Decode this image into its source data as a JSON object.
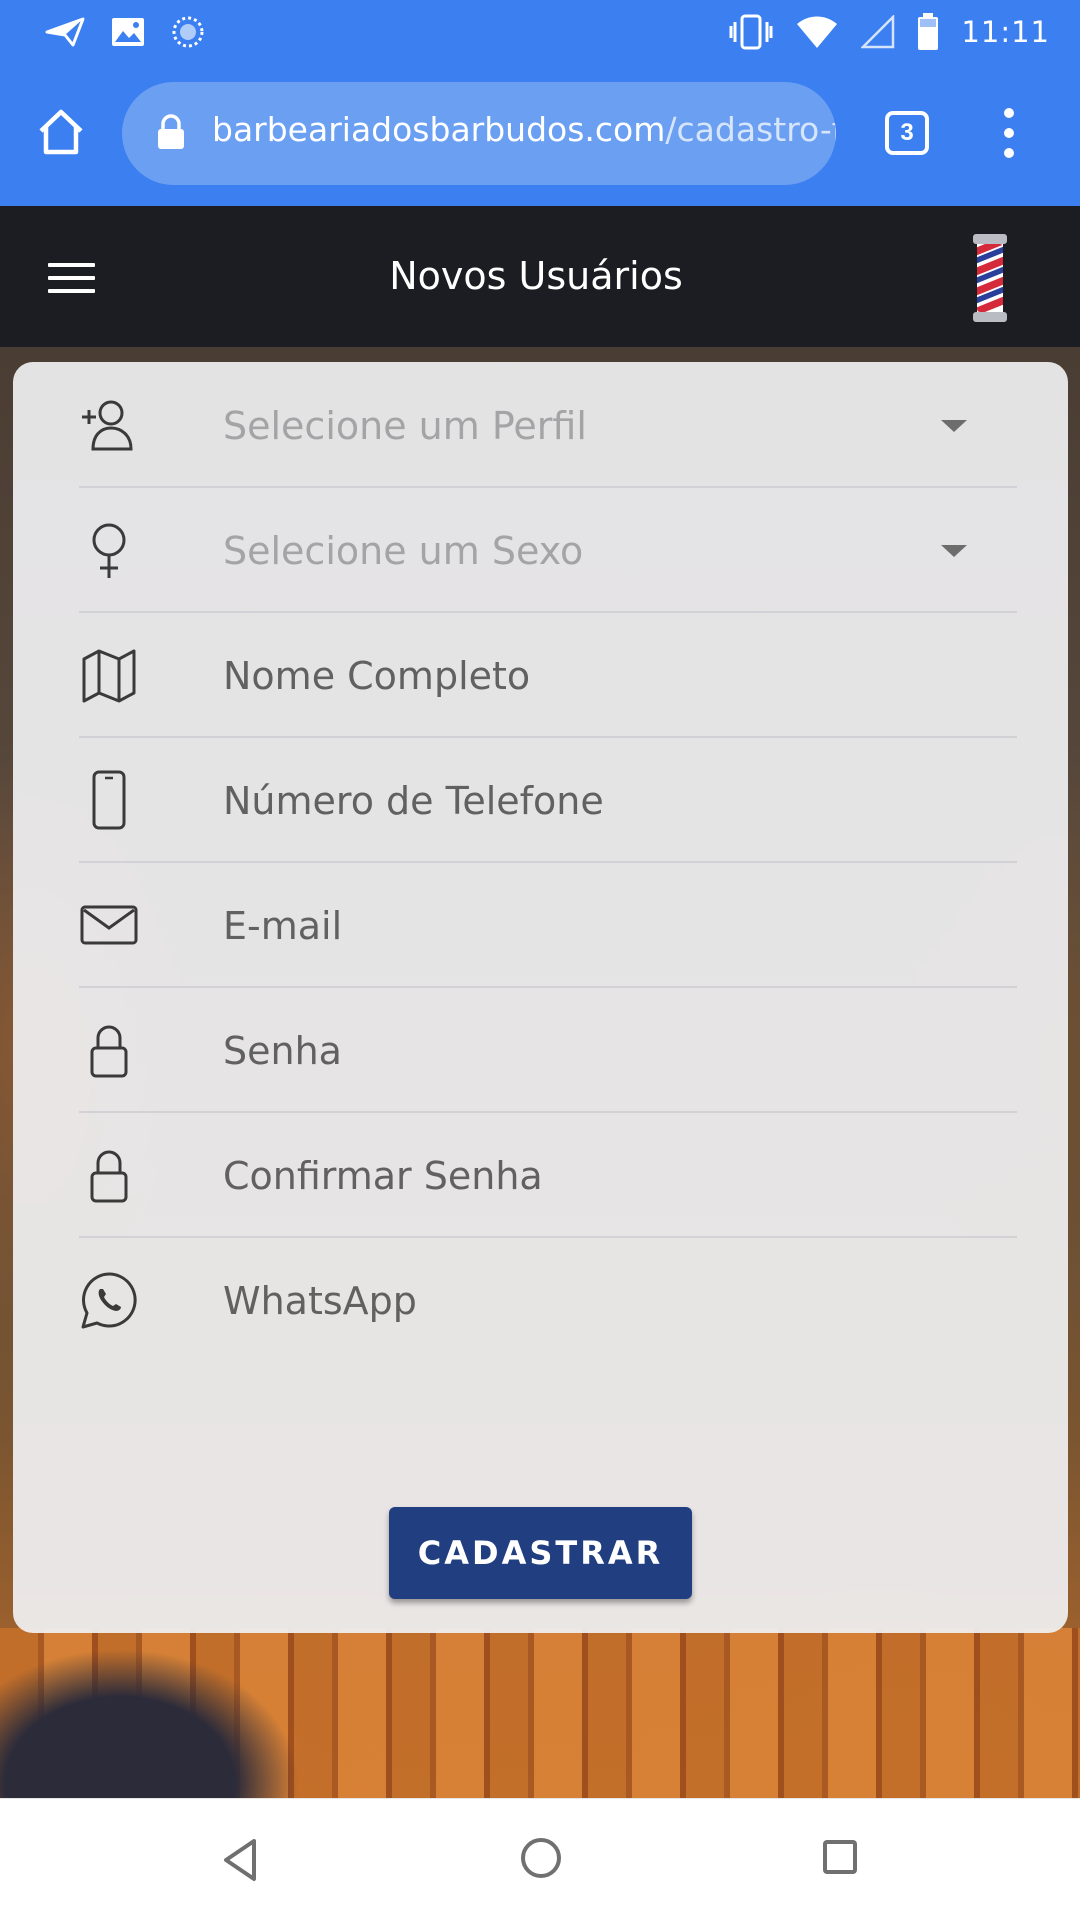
{
  "status_bar": {
    "time": "11:11",
    "icons": [
      "send-icon",
      "image-icon",
      "sync-icon",
      "vibrate-icon",
      "wifi-icon",
      "signal-icon",
      "battery-icon"
    ]
  },
  "browser": {
    "url_domain": "barbeariadosbarbudos.com",
    "url_path": "/cadastro-f",
    "tab_count": "3",
    "theme_color": "#3b7ff0"
  },
  "header": {
    "title": "Novos Usuários",
    "background": "#1b1d22"
  },
  "form": {
    "fields": [
      {
        "icon": "add-person-icon",
        "label": "Selecione um Perfil",
        "type": "select"
      },
      {
        "icon": "female-icon",
        "label": "Selecione um Sexo",
        "type": "select"
      },
      {
        "icon": "map-icon",
        "label": "Nome Completo",
        "type": "text"
      },
      {
        "icon": "phone-icon",
        "label": "Número de Telefone",
        "type": "tel"
      },
      {
        "icon": "mail-icon",
        "label": "E-mail",
        "type": "email"
      },
      {
        "icon": "lock-icon",
        "label": "Senha",
        "type": "password"
      },
      {
        "icon": "lock-icon",
        "label": "Confirmar Senha",
        "type": "password"
      },
      {
        "icon": "whatsapp-icon",
        "label": "WhatsApp",
        "type": "text"
      }
    ],
    "submit_label": "CADASTRAR",
    "submit_color": "#213e80"
  },
  "nav_bar": {
    "icons": [
      "back-icon",
      "home-icon",
      "recent-apps-icon"
    ]
  }
}
